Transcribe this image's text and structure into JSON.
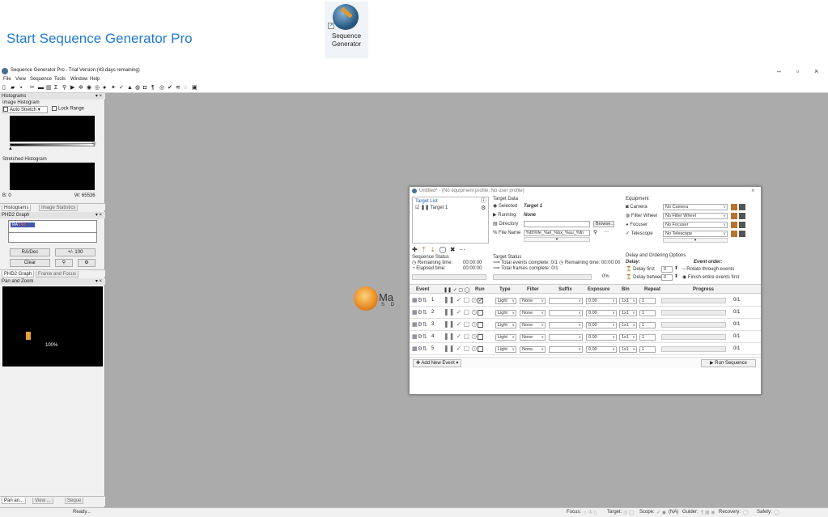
{
  "heading": "Start Sequence Generator Pro",
  "desktop_icon": {
    "label_line1": "Sequence",
    "label_line2": "Generator"
  },
  "window": {
    "title": "Sequence Generator Pro - Trial Version (43 days remaining)",
    "controls": {
      "minimize": "–",
      "maximize": "▫",
      "close": "×"
    }
  },
  "menu": [
    "File",
    "View",
    "Sequence",
    "Tools",
    "Window",
    "Help"
  ],
  "toolbar_icons": [
    "new-icon",
    "open-icon",
    "save-icon",
    "tools-icon",
    "image-icon",
    "chart-icon",
    "sigma-icon",
    "zoom-icon",
    "play-icon",
    "target-icon",
    "focus-icon",
    "camera-icon",
    "filter-icon",
    "plate-icon",
    "telescope-icon",
    "mount-icon",
    "dome-icon",
    "rotator-icon",
    "guide-icon",
    "weather-icon",
    "safety-icon",
    "flat-icon",
    "settings-icon"
  ],
  "histogram_panel": {
    "header": "Histograms",
    "image_histogram": "Image Histogram",
    "auto_stretch": "Auto Stretch",
    "lock_range": "Lock Range",
    "stretched": "Stretched Histogram",
    "b": "B: 0",
    "w": "W: 65536",
    "tabs": [
      "Histograms",
      "Image Statistics"
    ]
  },
  "phd2_panel": {
    "header": "PHD2 Graph",
    "legend_ra": "RA",
    "legend_dec": "Dec",
    "radec_btn": "RA/Dec",
    "scale": "+/- 100",
    "clear_btn": "Clear",
    "tabs": [
      "PHD2 Graph",
      "Frame and Focus"
    ]
  },
  "pan_zoom": {
    "header": "Pan and Zoom",
    "zoom": "100%",
    "tabs": [
      "Pan an...",
      "View ...",
      "Seque"
    ]
  },
  "statusbar": {
    "ready": "Ready...",
    "focus": "Focus:",
    "target": "Target:",
    "scope": "Scope:",
    "na": "(NA)",
    "guider": "Guider:",
    "recovery": "Recovery:",
    "safety": "Safety:"
  },
  "background_logo": {
    "text": "Ma",
    "sub": "S D"
  },
  "sequence": {
    "title": "Untitled* - (No equipment profile; No user profile)",
    "target_list": "Target List",
    "target_item": "Target 1",
    "target_data": "Target Data",
    "selected_lbl": "Selected",
    "selected_val": "Target 1",
    "running_lbl": "Running",
    "running_val": "None",
    "directory_lbl": "Directory",
    "browse": "Browse...",
    "filename_lbl": "File Name",
    "filename_val": "%tt\\%fe_%el_%bx_%su_%fn",
    "equipment": "Equipment",
    "camera_lbl": "Camera",
    "camera_val": "No Camera",
    "filterwheel_lbl": "Filter Wheel",
    "filterwheel_val": "No Filter Wheel",
    "focuser_lbl": "Focuser",
    "focuser_val": "No Focuser",
    "telescope_lbl": "Telescope",
    "telescope_val": "No Telescope",
    "seq_status": "Sequence Status",
    "remaining": "Remaining time:",
    "remaining_val": "00:00:00",
    "elapsed": "Elapsed time:",
    "elapsed_val": "00:00:00",
    "target_status": "Target Status",
    "total_events": "Total events complete: 0/1",
    "remaining_time2": "Remaining time: 00:00:00",
    "total_frames": "Total frames complete: 0/1",
    "pct": "0%",
    "delay_opts": "Delay and Ordering Options",
    "delay": "Delay:",
    "delay_first": "Delay first",
    "delay_first_val": "0",
    "delay_between": "Delay between",
    "delay_between_val": "0",
    "event_order": "Event order:",
    "rotate": "Rotate through events",
    "finish": "Finish entire events first",
    "cols": [
      "Event",
      "Run",
      "Type",
      "Filter",
      "Suffix",
      "Exposure",
      "Bin",
      "Repeat",
      "Progress"
    ],
    "rows": [
      {
        "n": "1",
        "type": "Light",
        "filter": "None",
        "exp": "0.00",
        "bin": "1x1",
        "repeat": "1",
        "progress": "0/1",
        "run": true
      },
      {
        "n": "2",
        "type": "Light",
        "filter": "None",
        "exp": "0.00",
        "bin": "1x1",
        "repeat": "1",
        "progress": "0/1",
        "run": false
      },
      {
        "n": "3",
        "type": "Light",
        "filter": "None",
        "exp": "0.00",
        "bin": "1x1",
        "repeat": "1",
        "progress": "0/1",
        "run": false
      },
      {
        "n": "4",
        "type": "Light",
        "filter": "None",
        "exp": "0.00",
        "bin": "1x1",
        "repeat": "1",
        "progress": "0/1",
        "run": false
      },
      {
        "n": "5",
        "type": "Light",
        "filter": "None",
        "exp": "0.00",
        "bin": "1x1",
        "repeat": "1",
        "progress": "0/1",
        "run": false
      }
    ],
    "add_event": "Add New Event",
    "run_sequence": "Run Sequence"
  },
  "colors": {
    "heading": "#1f7ad4",
    "workspace": "#ababab",
    "accent_orange": "#b9722e"
  }
}
